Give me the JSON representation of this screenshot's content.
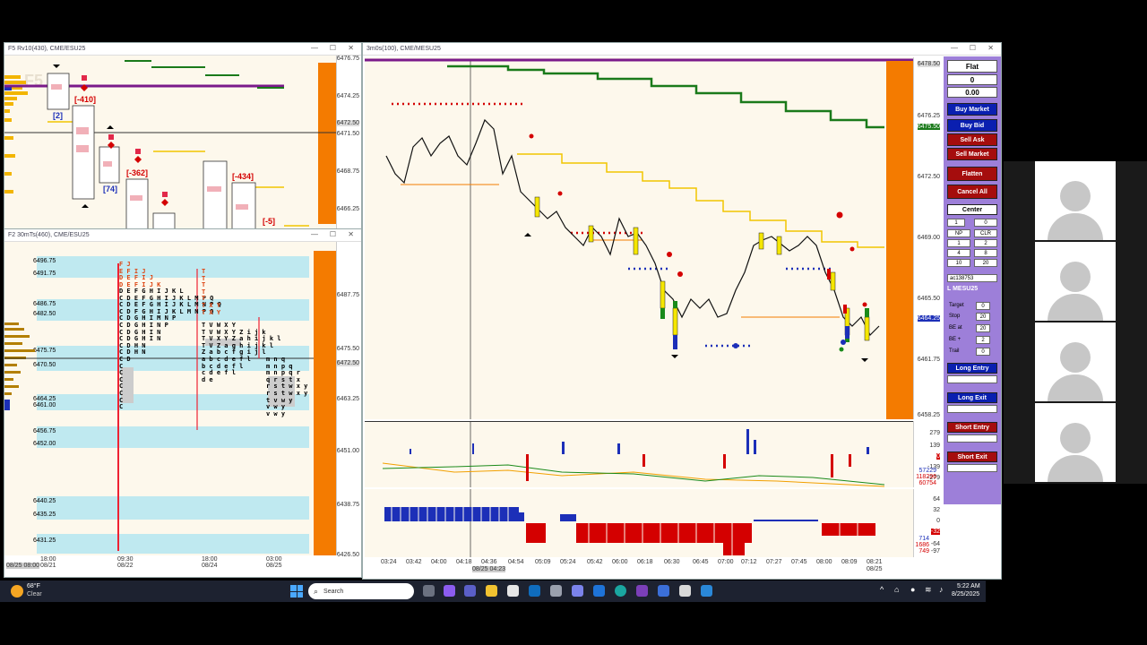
{
  "windows": {
    "top_left": {
      "title": "F5 Rv10(430), CME/ESU25",
      "logo": "F5",
      "prices": [
        "6476.75",
        "6474.25",
        "6472.50",
        "6471.50",
        "6468.75",
        "6466.25"
      ],
      "deltas": [
        "[-410]",
        "[2]",
        "[-362]",
        "[74]",
        "[-434]",
        "[-5]"
      ]
    },
    "bottom_left": {
      "title": "F2 30mTs(460), CME/ESU25",
      "levels": [
        "6496.75",
        "6491.75",
        "6486.75",
        "6482.50",
        "6475.75",
        "6470.50",
        "6464.25",
        "6461.00",
        "6456.75",
        "6452.00",
        "6440.25",
        "6435.25",
        "6431.25"
      ],
      "right_prices": [
        "6487.75",
        "6475.50",
        "6472.50",
        "6463.25",
        "6451.00",
        "6438.75",
        "6426.50"
      ],
      "time_labels": [
        {
          "t": "18:00",
          "d": "08/21"
        },
        {
          "t": "09:30",
          "d": "08/22"
        },
        {
          "t": "18:00",
          "d": "08/24"
        },
        {
          "t": "03:00",
          "d": "08/25"
        }
      ],
      "corner_label": "08/25 08:00"
    },
    "main": {
      "title": "3m0s(100), CME/MESU25",
      "prices": [
        "6478.50",
        "6476.25",
        "6475.50",
        "6472.50",
        "6469.00",
        "6465.50",
        "6464.25",
        "6461.75",
        "6458.25"
      ],
      "indicator1": [
        "279",
        "139",
        "0",
        "-139",
        "-279"
      ],
      "indicator1_vals": [
        "57229",
        "118296",
        "60754"
      ],
      "indicator2": [
        "64",
        "32",
        "0",
        "-32",
        "-64",
        "-97"
      ],
      "indicator2_vals": [
        "714",
        "1686",
        "749"
      ],
      "times": [
        "03:24",
        "03:42",
        "04:00",
        "04:18",
        "04:36",
        "04:54",
        "05:09",
        "05:24",
        "05:42",
        "06:00",
        "06:18",
        "06:30",
        "06:45",
        "07:00",
        "07:12",
        "07:27",
        "07:45",
        "08:00",
        "08:09",
        "08:21"
      ],
      "cursor_time": "08/25 04:23",
      "last_date": "08/25"
    }
  },
  "order_panel": {
    "position": "Flat",
    "qty": "0",
    "pnl": "0.00",
    "buttons": {
      "buy_market": "Buy Market",
      "buy_bid": "Buy Bid",
      "sell_ask": "Sell Ask",
      "sell_market": "Sell Market",
      "flatten": "Flatten",
      "cancel_all": "Cancel All",
      "center": "Center"
    },
    "qty_field": "1",
    "qty_field2": "0",
    "grid": [
      "NP",
      "CLR",
      "1",
      "2",
      "4",
      "8",
      "10",
      "20"
    ],
    "account": "ac138753",
    "symbol": "L MESU25",
    "params": [
      {
        "label": "Target",
        "val": "0"
      },
      {
        "label": "Stop",
        "val": "20"
      },
      {
        "label": "BE at",
        "val": "20"
      },
      {
        "label": "BE +",
        "val": "2"
      },
      {
        "label": "Trail",
        "val": "0"
      }
    ],
    "entries": [
      "Long Entry",
      "Long Exit",
      "Short Entry",
      "Short Exit"
    ]
  },
  "taskbar": {
    "weather_temp": "68°F",
    "weather_desc": "Clear",
    "search_placeholder": "Search",
    "time": "5:22 AM",
    "date": "8/25/2025"
  },
  "colors": {
    "buy": "#0a1fb0",
    "sell": "#a50d0d",
    "panel": "#9d7fd9",
    "profile": "#f47b00"
  }
}
